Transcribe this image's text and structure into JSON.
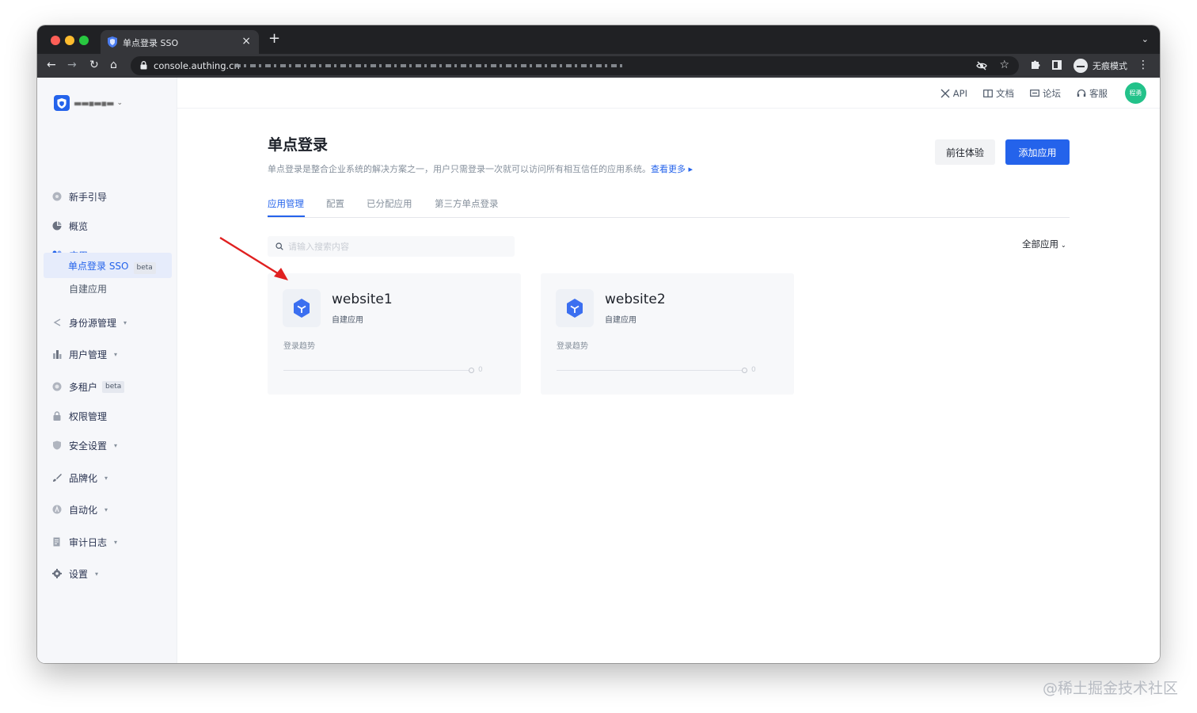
{
  "browser": {
    "tab_title": "单点登录 SSO",
    "tab_close": "×",
    "new_tab": "+",
    "tab_menu": "⌄",
    "url": "console.authing.cn",
    "incognito_label": "无痕模式"
  },
  "sidebar": {
    "org_name": "▬▬▪▬▪▬",
    "items": [
      {
        "label": "新手引导",
        "icon": "guide-icon"
      },
      {
        "label": "概览",
        "icon": "pie-chart-icon"
      },
      {
        "label": "应用",
        "icon": "apps-icon",
        "caret": "▴"
      },
      {
        "label": "身份源管理",
        "icon": "share-icon",
        "caret": "▾"
      },
      {
        "label": "用户管理",
        "icon": "users-icon",
        "caret": "▾"
      },
      {
        "label": "多租户",
        "icon": "tenant-icon",
        "badge": "beta"
      },
      {
        "label": "权限管理",
        "icon": "lock-icon"
      },
      {
        "label": "安全设置",
        "icon": "shield-icon",
        "caret": "▾"
      },
      {
        "label": "品牌化",
        "icon": "brush-icon",
        "caret": "▾"
      },
      {
        "label": "自动化",
        "icon": "automation-icon",
        "caret": "▾"
      },
      {
        "label": "审计日志",
        "icon": "log-icon",
        "caret": "▾"
      },
      {
        "label": "设置",
        "icon": "gear-icon",
        "caret": "▾"
      }
    ],
    "sub_items": [
      {
        "label": "自建应用"
      },
      {
        "label": "单点登录 SSO",
        "badge": "beta"
      }
    ]
  },
  "header": {
    "links": [
      {
        "label": "API",
        "icon": "api-icon"
      },
      {
        "label": "文档",
        "icon": "book-icon"
      },
      {
        "label": "论坛",
        "icon": "forum-icon"
      },
      {
        "label": "客服",
        "icon": "headset-icon"
      }
    ],
    "avatar_text": "程勇"
  },
  "page": {
    "title": "单点登录",
    "description": "单点登录是整合企业系统的解决方案之一，用户只需登录一次就可以访问所有相互信任的应用系统。",
    "more_link": "查看更多 ▸",
    "try_button": "前往体验",
    "add_button": "添加应用",
    "tabs": [
      "应用管理",
      "配置",
      "已分配应用",
      "第三方单点登录"
    ],
    "search_placeholder": "请输入搜索内容",
    "filter_label": "全部应用"
  },
  "apps": [
    {
      "name": "website1",
      "type": "自建应用",
      "trend_label": "登录趋势",
      "value": "0"
    },
    {
      "name": "website2",
      "type": "自建应用",
      "trend_label": "登录趋势",
      "value": "0"
    }
  ],
  "watermark": "@稀土掘金技术社区",
  "colors": {
    "accent": "#2463eb",
    "annotation_arrow": "#e02020",
    "avatar": "#23c28a"
  }
}
